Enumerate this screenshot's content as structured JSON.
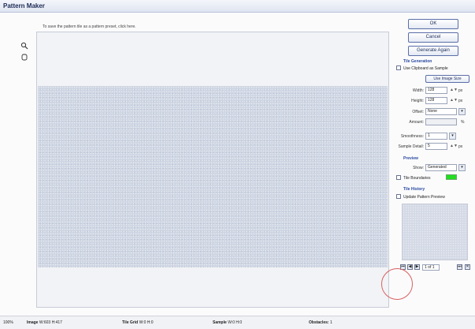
{
  "window": {
    "title": "Pattern Maker"
  },
  "canvas": {
    "hint": "To save the pattern tile as a pattern preset, click here."
  },
  "tools": [
    {
      "name": "zoom-tool",
      "icon": "magnifier-icon"
    },
    {
      "name": "hand-tool",
      "icon": "hand-icon"
    }
  ],
  "panel": {
    "ok_label": "OK",
    "cancel_label": "Cancel",
    "generate_label": "Generate Again",
    "tile_generation": {
      "heading": "Tile Generation",
      "use_clipboard_label": "Use Clipboard as Sample",
      "use_image_size_label": "Use Image Size",
      "width_label": "Width:",
      "width_value": "128",
      "height_label": "Height:",
      "height_value": "128",
      "unit": "px",
      "offset_label": "Offset:",
      "offset_value": "None",
      "amount_label": "Amount:",
      "amount_unit": "%",
      "smoothness_label": "Smoothness:",
      "smoothness_value": "1",
      "sample_detail_label": "Sample Detail:",
      "sample_detail_value": "5"
    },
    "preview": {
      "heading": "Preview",
      "show_label": "Show:",
      "show_value": "Generated",
      "tile_boundaries_label": "Tile Boundaries",
      "tile_boundaries_color": "#22dd22"
    },
    "tile_history": {
      "heading": "Tile History",
      "update_label": "Update Pattern Preview",
      "page_value": "1 of 1"
    }
  },
  "status": {
    "zoom": "100%",
    "image_label": "Image",
    "image_value": "W:603 H:417",
    "tile_label": "Tile Grid",
    "tile_value": "W:0 H:0",
    "sample_label": "Sample",
    "sample_value": "W:0 H:0",
    "obstacle_label": "Obstacles:",
    "obstacle_value": "1"
  }
}
